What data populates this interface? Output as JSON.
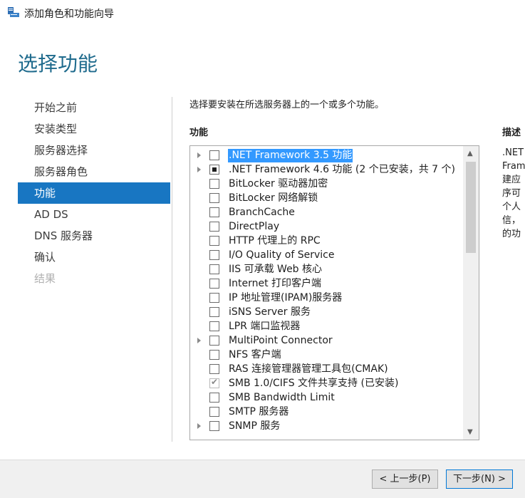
{
  "window": {
    "title": "添加角色和功能向导",
    "app_icon": "server-manager-icon"
  },
  "page_title": "选择功能",
  "nav": {
    "items": [
      {
        "label": "开始之前",
        "state": "normal"
      },
      {
        "label": "安装类型",
        "state": "normal"
      },
      {
        "label": "服务器选择",
        "state": "normal"
      },
      {
        "label": "服务器角色",
        "state": "normal"
      },
      {
        "label": "功能",
        "state": "active"
      },
      {
        "label": "AD DS",
        "state": "normal"
      },
      {
        "label": "DNS 服务器",
        "state": "normal"
      },
      {
        "label": "确认",
        "state": "normal"
      },
      {
        "label": "结果",
        "state": "disabled"
      }
    ]
  },
  "instruction": "选择要安装在所选服务器上的一个或多个功能。",
  "features": {
    "heading": "功能",
    "items": [
      {
        "label": ".NET Framework 3.5 功能",
        "expandable": true,
        "check": "unchecked",
        "selected": true
      },
      {
        "label": ".NET Framework 4.6 功能 (2 个已安装，共 7 个)",
        "expandable": true,
        "check": "partial",
        "selected": false
      },
      {
        "label": "BitLocker 驱动器加密",
        "expandable": false,
        "check": "unchecked",
        "selected": false
      },
      {
        "label": "BitLocker 网络解锁",
        "expandable": false,
        "check": "unchecked",
        "selected": false
      },
      {
        "label": "BranchCache",
        "expandable": false,
        "check": "unchecked",
        "selected": false
      },
      {
        "label": "DirectPlay",
        "expandable": false,
        "check": "unchecked",
        "selected": false
      },
      {
        "label": "HTTP 代理上的 RPC",
        "expandable": false,
        "check": "unchecked",
        "selected": false
      },
      {
        "label": "I/O Quality of Service",
        "expandable": false,
        "check": "unchecked",
        "selected": false
      },
      {
        "label": "IIS 可承载 Web 核心",
        "expandable": false,
        "check": "unchecked",
        "selected": false
      },
      {
        "label": "Internet 打印客户端",
        "expandable": false,
        "check": "unchecked",
        "selected": false
      },
      {
        "label": "IP 地址管理(IPAM)服务器",
        "expandable": false,
        "check": "unchecked",
        "selected": false
      },
      {
        "label": "iSNS Server 服务",
        "expandable": false,
        "check": "unchecked",
        "selected": false
      },
      {
        "label": "LPR 端口监视器",
        "expandable": false,
        "check": "unchecked",
        "selected": false
      },
      {
        "label": "MultiPoint Connector",
        "expandable": true,
        "check": "unchecked",
        "selected": false
      },
      {
        "label": "NFS 客户端",
        "expandable": false,
        "check": "unchecked",
        "selected": false
      },
      {
        "label": "RAS 连接管理器管理工具包(CMAK)",
        "expandable": false,
        "check": "unchecked",
        "selected": false
      },
      {
        "label": "SMB 1.0/CIFS 文件共享支持 (已安装)",
        "expandable": false,
        "check": "checked-disabled",
        "selected": false
      },
      {
        "label": "SMB Bandwidth Limit",
        "expandable": false,
        "check": "unchecked",
        "selected": false
      },
      {
        "label": "SMTP 服务器",
        "expandable": false,
        "check": "unchecked",
        "selected": false
      },
      {
        "label": "SNMP 服务",
        "expandable": true,
        "check": "unchecked",
        "selected": false
      }
    ]
  },
  "description": {
    "heading": "描述",
    "lines": [
      ".NET",
      "Fram",
      "建应",
      "序可",
      "个人",
      "信，",
      "的功"
    ]
  },
  "buttons": {
    "prev": "< 上一步(P)",
    "next": "下一步(N) >"
  },
  "colors": {
    "title_accent": "#1f6b8d",
    "nav_active": "#1876c2",
    "selection": "#3399ff"
  }
}
